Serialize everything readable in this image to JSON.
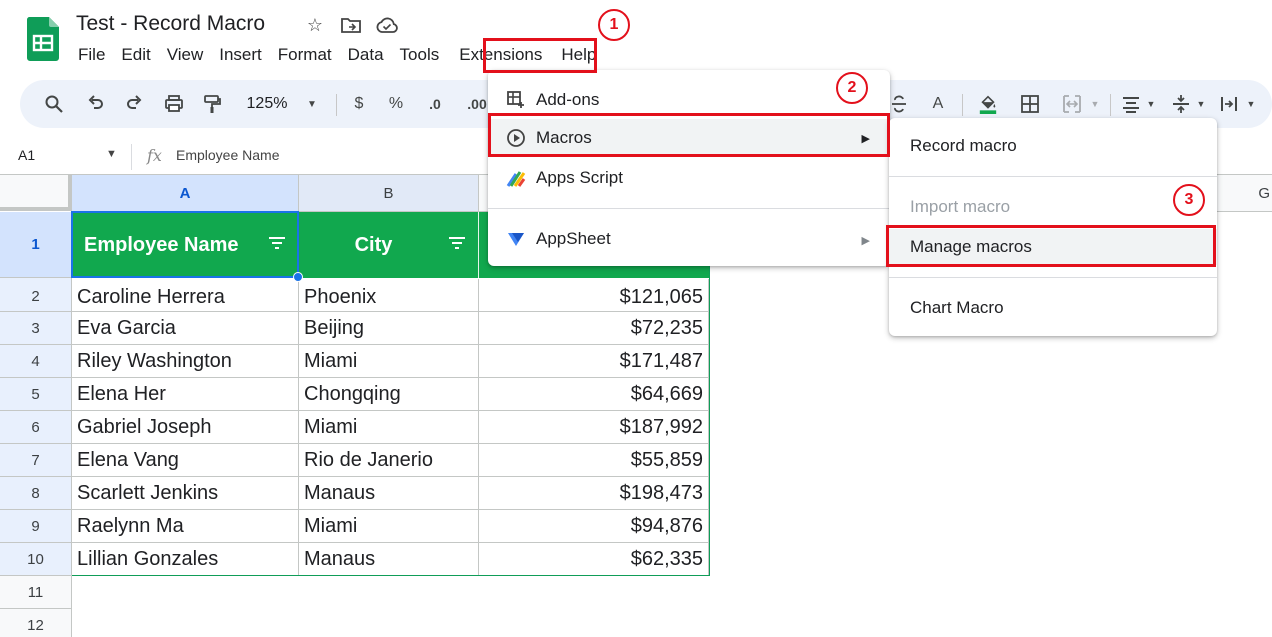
{
  "app": {
    "doc_title": "Test - Record Macro",
    "menus": [
      "File",
      "Edit",
      "View",
      "Insert",
      "Format",
      "Data",
      "Tools",
      "Extensions",
      "Help"
    ]
  },
  "toolbar": {
    "zoom": "125%",
    "currency": "$",
    "percent": "%",
    "decimal_decrease": ".0",
    "decimal_increase": ".00",
    "text_color_label": "A"
  },
  "formula_bar": {
    "name_box": "A1",
    "fx": "fx",
    "value": "Employee Name"
  },
  "grid": {
    "columns": [
      "A",
      "B",
      "G"
    ],
    "rows": [
      "1",
      "2",
      "3",
      "4",
      "5",
      "6",
      "7",
      "8",
      "9",
      "10",
      "11",
      "12"
    ],
    "headers": [
      "Employee Name",
      "City"
    ],
    "data": [
      [
        "Caroline Herrera",
        "Phoenix",
        "$121,065"
      ],
      [
        "Eva Garcia",
        "Beijing",
        "$72,235"
      ],
      [
        "Riley Washington",
        "Miami",
        "$171,487"
      ],
      [
        "Elena Her",
        "Chongqing",
        "$64,669"
      ],
      [
        "Gabriel Joseph",
        "Miami",
        "$187,992"
      ],
      [
        "Elena Vang",
        "Rio de Janerio",
        "$55,859"
      ],
      [
        "Scarlett Jenkins",
        "Manaus",
        "$198,473"
      ],
      [
        "Raelynn Ma",
        "Miami",
        "$94,876"
      ],
      [
        "Lillian Gonzales",
        "Manaus",
        "$62,335"
      ]
    ]
  },
  "extensions_menu": {
    "items": [
      "Add-ons",
      "Macros",
      "Apps Script",
      "AppSheet"
    ]
  },
  "macros_submenu": {
    "items": [
      "Record macro",
      "Import macro",
      "Manage macros",
      "Chart Macro"
    ]
  },
  "callouts": [
    "1",
    "2",
    "3"
  ],
  "colors": {
    "sheet_green": "#11a84e",
    "callout_red": "#e3101b",
    "selection_blue": "#1a73e8",
    "toolbar_bg": "#edf2fa"
  }
}
